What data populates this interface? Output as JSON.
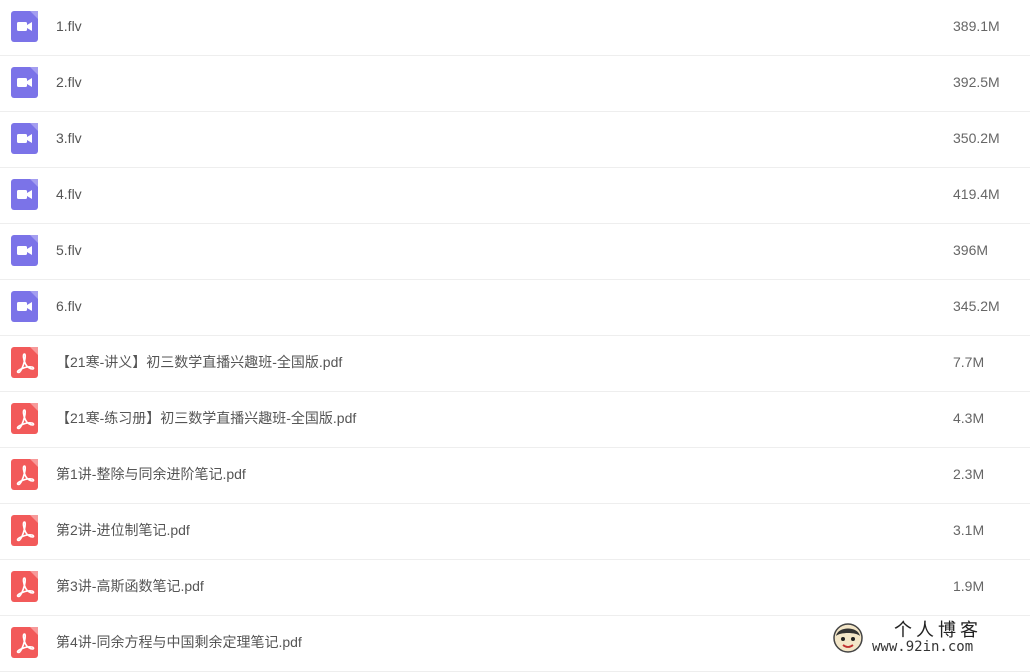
{
  "files": [
    {
      "name": "1.flv",
      "size": "389.1M",
      "type": "video"
    },
    {
      "name": "2.flv",
      "size": "392.5M",
      "type": "video"
    },
    {
      "name": "3.flv",
      "size": "350.2M",
      "type": "video"
    },
    {
      "name": "4.flv",
      "size": "419.4M",
      "type": "video"
    },
    {
      "name": "5.flv",
      "size": "396M",
      "type": "video"
    },
    {
      "name": "6.flv",
      "size": "345.2M",
      "type": "video"
    },
    {
      "name": "【21寒-讲义】初三数学直播兴趣班-全国版.pdf",
      "size": "7.7M",
      "type": "pdf"
    },
    {
      "name": "【21寒-练习册】初三数学直播兴趣班-全国版.pdf",
      "size": "4.3M",
      "type": "pdf"
    },
    {
      "name": "第1讲-整除与同余进阶笔记.pdf",
      "size": "2.3M",
      "type": "pdf"
    },
    {
      "name": "第2讲-进位制笔记.pdf",
      "size": "3.1M",
      "type": "pdf"
    },
    {
      "name": "第3讲-高斯函数笔记.pdf",
      "size": "1.9M",
      "type": "pdf"
    },
    {
      "name": "第4讲-同余方程与中国剩余定理笔记.pdf",
      "size": "",
      "type": "pdf"
    }
  ],
  "icons": {
    "video": {
      "name": "video-file-icon",
      "color": "#7b73e8"
    },
    "pdf": {
      "name": "pdf-file-icon",
      "color": "#f25a5a"
    }
  },
  "watermark": {
    "title": "个人博客",
    "url": "www.92in.com"
  }
}
